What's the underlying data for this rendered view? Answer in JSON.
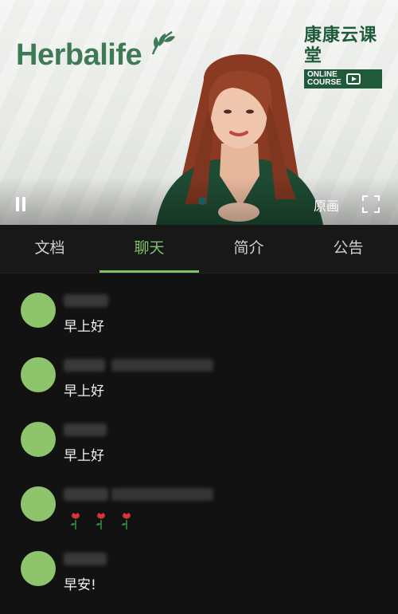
{
  "video": {
    "brand": "Herbalife",
    "course_title": "康康云课堂",
    "course_line1": "ONLINE",
    "course_line2": "COURSE",
    "quality_label": "原画"
  },
  "tabs": [
    {
      "label": "文档",
      "active": false
    },
    {
      "label": "聊天",
      "active": true
    },
    {
      "label": "简介",
      "active": false
    },
    {
      "label": "公告",
      "active": false
    }
  ],
  "colors": {
    "accent": "#7ec26d",
    "avatar": "#8ec46c",
    "background": "#121212",
    "brand_green": "#3e7a55"
  },
  "chat": {
    "messages": [
      {
        "text": "早上好"
      },
      {
        "text": "早上好"
      },
      {
        "text": "早上好"
      },
      {
        "emoji": [
          "rose-icon",
          "rose-icon",
          "rose-icon"
        ]
      },
      {
        "text": "早安!"
      }
    ]
  }
}
